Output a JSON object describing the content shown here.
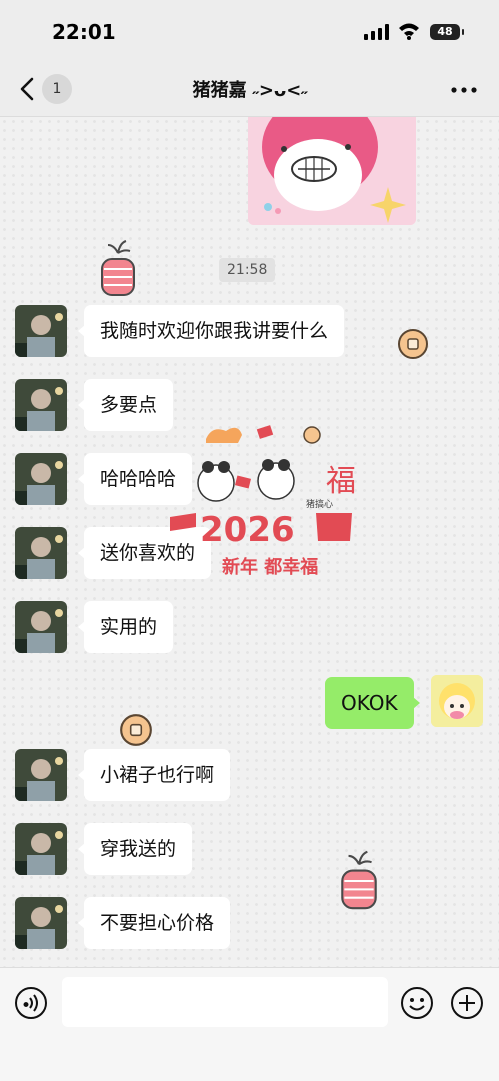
{
  "status_bar": {
    "time": "22:01",
    "battery": "48"
  },
  "header": {
    "unread_count": "1",
    "title": "猪猪嘉 ˶>ᴗ<˶"
  },
  "chat": {
    "timestamp": "21:58",
    "incoming": [
      {
        "text": "我随时欢迎你跟我讲要什么"
      },
      {
        "text": "多要点"
      },
      {
        "text": "哈哈哈哈"
      },
      {
        "text": "送你喜欢的"
      },
      {
        "text": "实用的"
      },
      {
        "text": "小裙子也行啊"
      },
      {
        "text": "穿我送的"
      },
      {
        "text": "不要担心价格"
      }
    ],
    "outgoing": [
      {
        "text": "OKOK"
      }
    ]
  },
  "overlay_sticker": {
    "text_year": "2026",
    "text_slogan": "新年 都幸福",
    "text_fu": "福",
    "text_small": "猪搞心"
  },
  "colors": {
    "outgoing_bubble": "#95ec69",
    "incoming_bubble": "#ffffff",
    "background": "#ededed"
  },
  "icons": [
    "back-icon",
    "more-icon",
    "voice-icon",
    "emoji-icon",
    "plus-icon"
  ]
}
